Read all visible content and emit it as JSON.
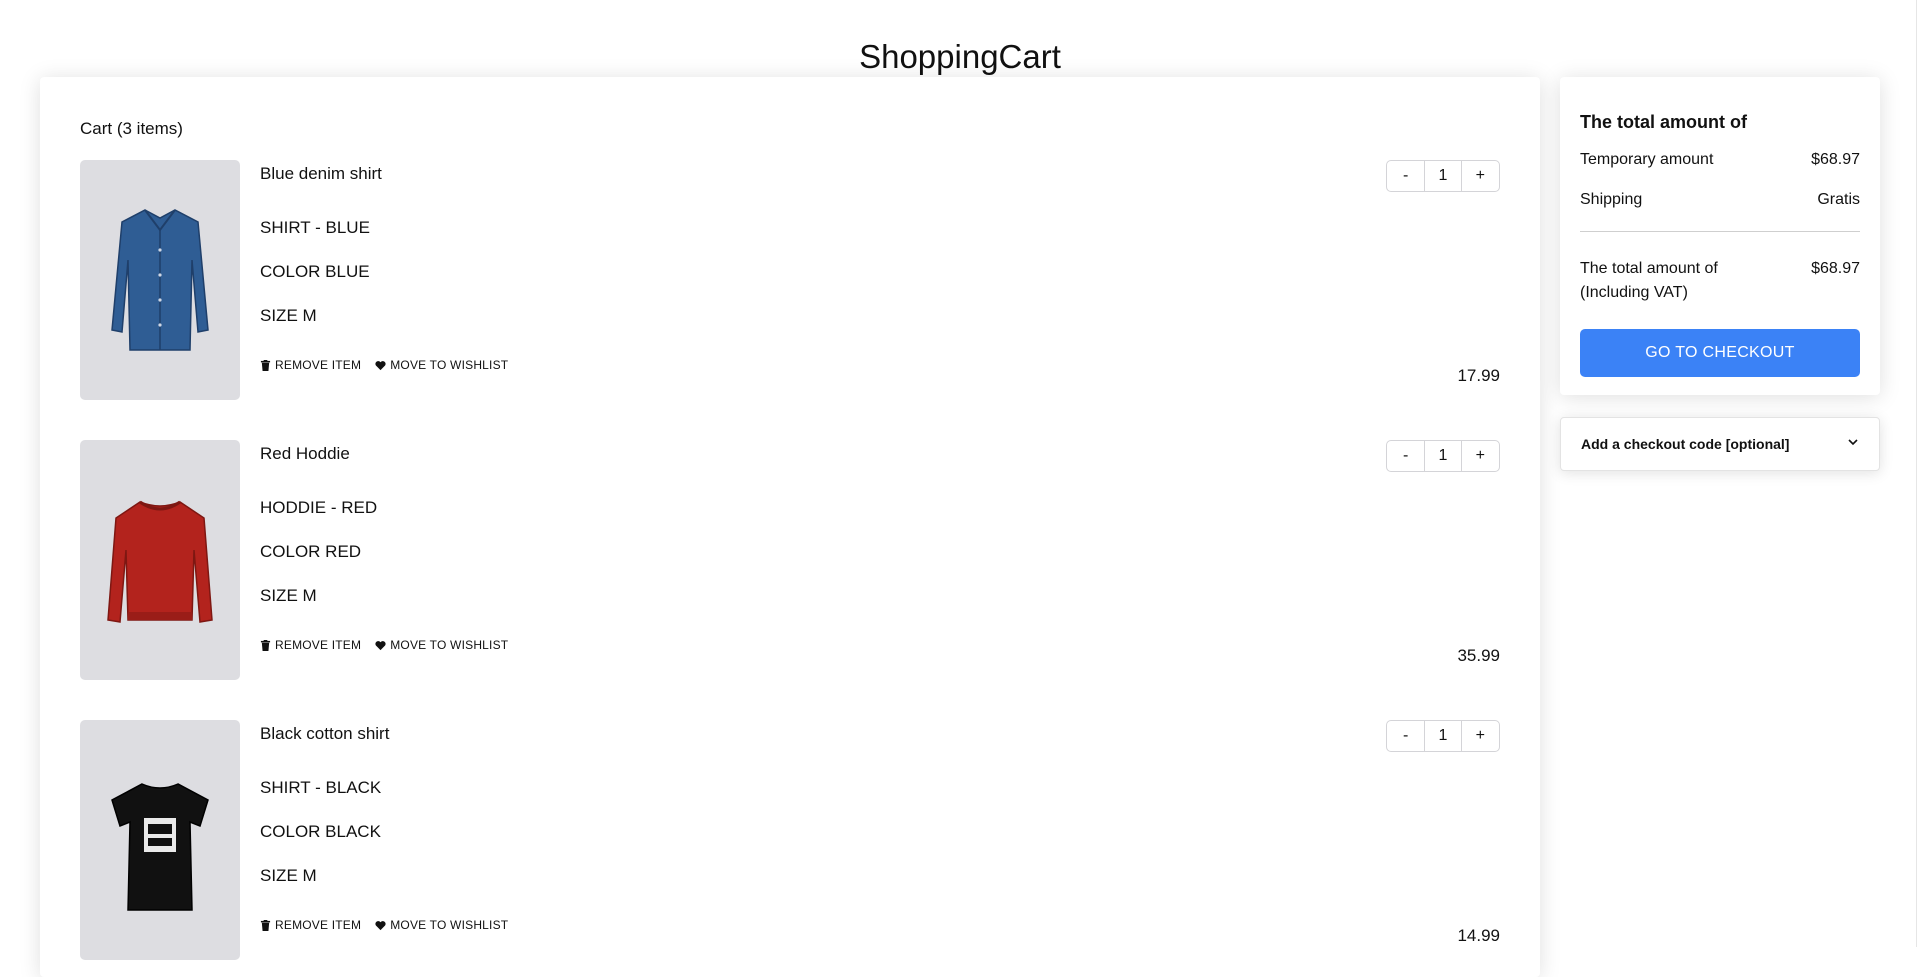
{
  "page_title": "ShoppingCart",
  "cart": {
    "heading": "Cart (3 items)",
    "items": [
      {
        "name": "Blue denim shirt",
        "attrs": [
          "SHIRT - BLUE",
          "COLOR BLUE",
          "SIZE M"
        ],
        "qty": "1",
        "price": "17.99",
        "remove_label": "REMOVE ITEM",
        "wishlist_label": "MOVE TO WISHLIST",
        "image_icon": "shirt-icon",
        "image_color": "#2f5d94"
      },
      {
        "name": "Red Hoddie",
        "attrs": [
          "HODDIE - RED",
          "COLOR RED",
          "SIZE M"
        ],
        "qty": "1",
        "price": "35.99",
        "remove_label": "REMOVE ITEM",
        "wishlist_label": "MOVE TO WISHLIST",
        "image_icon": "sweater-icon",
        "image_color": "#b3231d"
      },
      {
        "name": "Black cotton shirt",
        "attrs": [
          "SHIRT - BLACK",
          "COLOR BLACK",
          "SIZE M"
        ],
        "qty": "1",
        "price": "14.99",
        "remove_label": "REMOVE ITEM",
        "wishlist_label": "MOVE TO WISHLIST",
        "image_icon": "tshirt-icon",
        "image_color": "#111111"
      }
    ],
    "qty_minus": "-",
    "qty_plus": "+"
  },
  "summary": {
    "title": "The total amount of",
    "temporary_label": "Temporary amount",
    "temporary_value": "$68.97",
    "shipping_label": "Shipping",
    "shipping_value": "Gratis",
    "total_label": "The total amount of (Including VAT)",
    "total_value": "$68.97",
    "checkout_label": "GO TO CHECKOUT",
    "accent_color": "#3b82f6"
  },
  "checkout_code": {
    "label": "Add a checkout code [optional]"
  }
}
